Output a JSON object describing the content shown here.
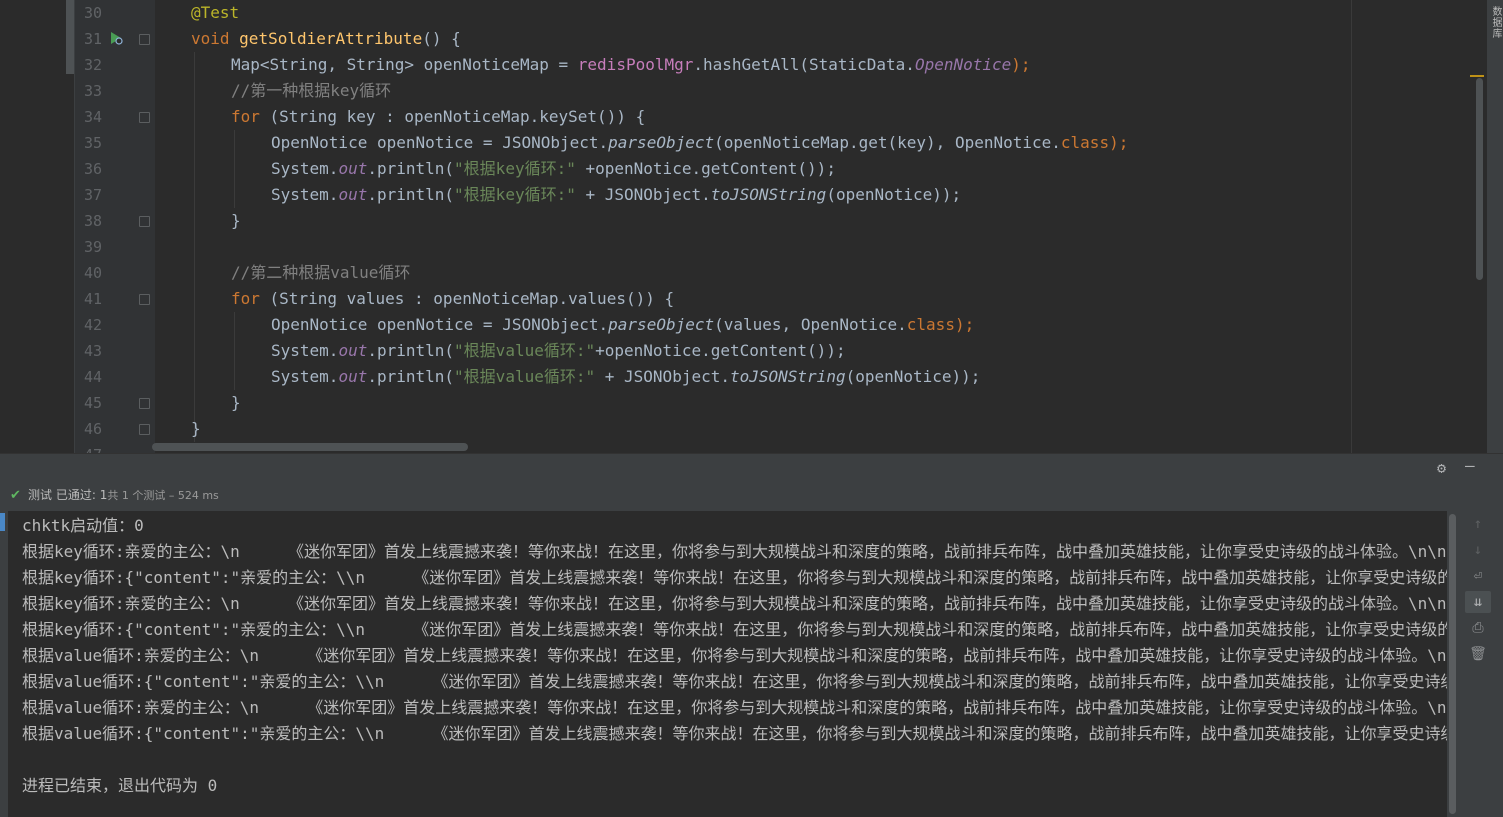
{
  "editor": {
    "line_numbers": [
      "30",
      "31",
      "32",
      "33",
      "34",
      "35",
      "36",
      "37",
      "38",
      "39",
      "40",
      "41",
      "42",
      "43",
      "44",
      "45",
      "46",
      "47"
    ],
    "code": {
      "l30_annotation": "@Test",
      "l31_void": "void",
      "l31_method": "getSoldierAttribute",
      "l31_rest": "() {",
      "l32_a": "Map<String, String> openNoticeMap = ",
      "l32_pool": "redisPoolMgr",
      "l32_b": ".hashGetAll(StaticData.",
      "l32_static": "OpenNotice",
      "l32_c": ");",
      "l33_comment": "//第一种根据key循环",
      "l34_for": "for",
      "l34_rest": " (String key : openNoticeMap.keySet()) {",
      "l35_a": "OpenNotice openNotice = JSONObject.",
      "l35_method": "parseObject",
      "l35_b": "(openNoticeMap.get(key), OpenNotice.",
      "l35_class": "class",
      "l35_c": ");",
      "l36_a": "System.",
      "l36_out": "out",
      "l36_b": ".println(",
      "l36_str": "\"根据key循环:\"",
      "l36_c": " +openNotice.getContent());",
      "l37_a": "System.",
      "l37_out": "out",
      "l37_b": ".println(",
      "l37_str": "\"根据key循环:\"",
      "l37_c": " + JSONObject.",
      "l37_method": "toJSONString",
      "l37_d": "(openNotice));",
      "l38": "}",
      "l40_comment": "//第二种根据value循环",
      "l41_for": "for",
      "l41_rest": " (String values : openNoticeMap.values()) {",
      "l42_a": "OpenNotice openNotice = JSONObject.",
      "l42_method": "parseObject",
      "l42_b": "(values, OpenNotice.",
      "l42_class": "class",
      "l42_c": ");",
      "l43_a": "System.",
      "l43_out": "out",
      "l43_b": ".println(",
      "l43_str": "\"根据value循环:\"",
      "l43_c": "+openNotice.getContent());",
      "l44_a": "System.",
      "l44_out": "out",
      "l44_b": ".println(",
      "l44_str": "\"根据value循环:\"",
      "l44_c": " + JSONObject.",
      "l44_method": "toJSONString",
      "l44_d": "(openNotice));",
      "l45": "}",
      "l46": "}"
    },
    "side_tab_label": "数据库"
  },
  "run_panel": {
    "status_test": "测试",
    "status_passed": "已通过:",
    "status_count": " 1",
    "status_meta": "共 1 个测试 – 524 ms",
    "console_lines": [
      "chktk启动值：0",
      "根据key循环:亲爱的主公：\\n     《迷你军团》首发上线震撼来袭！等你来战！在这里，你将参与到大规模战斗和深度的策略，战前排兵布阵，战中叠加英雄技能，让你享受史诗级的战斗体验。\\n\\n",
      "根据key循环:{\"content\":\"亲爱的主公：\\\\n     《迷你军团》首发上线震撼来袭！等你来战！在这里，你将参与到大规模战斗和深度的策略，战前排兵布阵，战中叠加英雄技能，让你享受史诗级的战",
      "根据key循环:亲爱的主公：\\n     《迷你军团》首发上线震撼来袭！等你来战！在这里，你将参与到大规模战斗和深度的策略，战前排兵布阵，战中叠加英雄技能，让你享受史诗级的战斗体验。\\n\\n",
      "根据key循环:{\"content\":\"亲爱的主公：\\\\n     《迷你军团》首发上线震撼来袭！等你来战！在这里，你将参与到大规模战斗和深度的策略，战前排兵布阵，战中叠加英雄技能，让你享受史诗级的战",
      "根据value循环:亲爱的主公：\\n     《迷你军团》首发上线震撼来袭！等你来战！在这里，你将参与到大规模战斗和深度的策略，战前排兵布阵，战中叠加英雄技能，让你享受史诗级的战斗体验。\\n\\n",
      "根据value循环:{\"content\":\"亲爱的主公：\\\\n     《迷你军团》首发上线震撼来袭！等你来战！在这里，你将参与到大规模战斗和深度的策略，战前排兵布阵，战中叠加英雄技能，让你享受史诗级",
      "根据value循环:亲爱的主公：\\n     《迷你军团》首发上线震撼来袭！等你来战！在这里，你将参与到大规模战斗和深度的策略，战前排兵布阵，战中叠加英雄技能，让你享受史诗级的战斗体验。\\n\\n",
      "根据value循环:{\"content\":\"亲爱的主公：\\\\n     《迷你军团》首发上线震撼来袭！等你来战！在这里，你将参与到大规模战斗和深度的策略，战前排兵布阵，战中叠加英雄技能，让你享受史诗级",
      "",
      "进程已结束，退出代码为 0"
    ],
    "icons": {
      "settings": "gear-icon",
      "minimize": "minimize-icon",
      "passed": "check-icon",
      "run_gutter": "run-test-icon",
      "up": "arrow-up-icon",
      "down": "arrow-down-icon",
      "soft_wrap": "soft-wrap-icon",
      "scroll_end": "scroll-to-end-icon",
      "print": "print-icon",
      "clear": "trash-icon"
    },
    "colors": {
      "keyword": "#cc7832",
      "string": "#6a8759",
      "comment": "#808080",
      "annotation": "#bbb529",
      "method_decl": "#ffc66d",
      "static_field": "#9876aa",
      "passed": "#5fb761"
    }
  }
}
